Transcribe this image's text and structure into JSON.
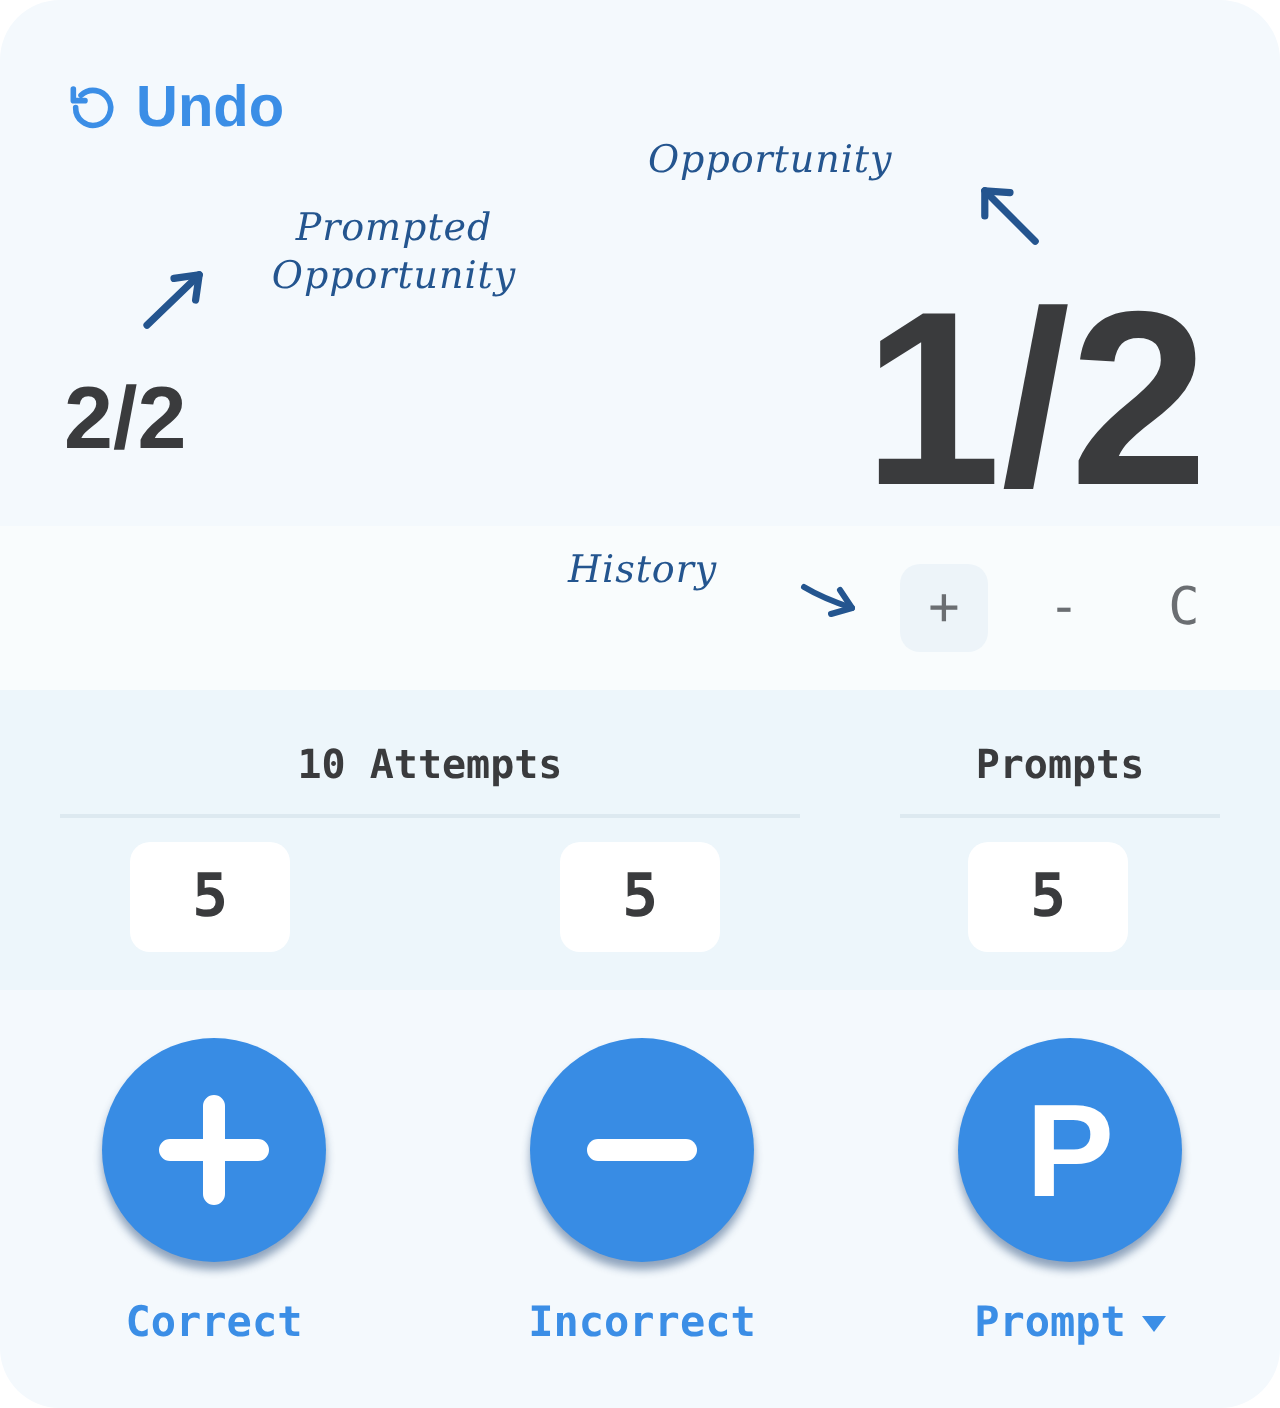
{
  "undo": {
    "label": "Undo"
  },
  "prompted_opportunity": {
    "value": "2/2",
    "annotation": "Prompted Opportunity"
  },
  "opportunity": {
    "value": "1/2",
    "annotation": "Opportunity"
  },
  "history": {
    "annotation": "History",
    "buttons": [
      {
        "label": "+",
        "selected": true
      },
      {
        "label": "-",
        "selected": false
      },
      {
        "label": "C",
        "selected": false
      }
    ]
  },
  "attempts": {
    "title": "10 Attempts",
    "values": [
      "5",
      "5"
    ]
  },
  "prompts": {
    "title": "Prompts",
    "value": "5"
  },
  "actions": [
    {
      "kind": "plus",
      "label": "Correct",
      "dropdown": false
    },
    {
      "kind": "minus",
      "label": "Incorrect",
      "dropdown": false
    },
    {
      "kind": "letter",
      "glyph": "P",
      "label": "Prompt",
      "dropdown": true
    }
  ]
}
